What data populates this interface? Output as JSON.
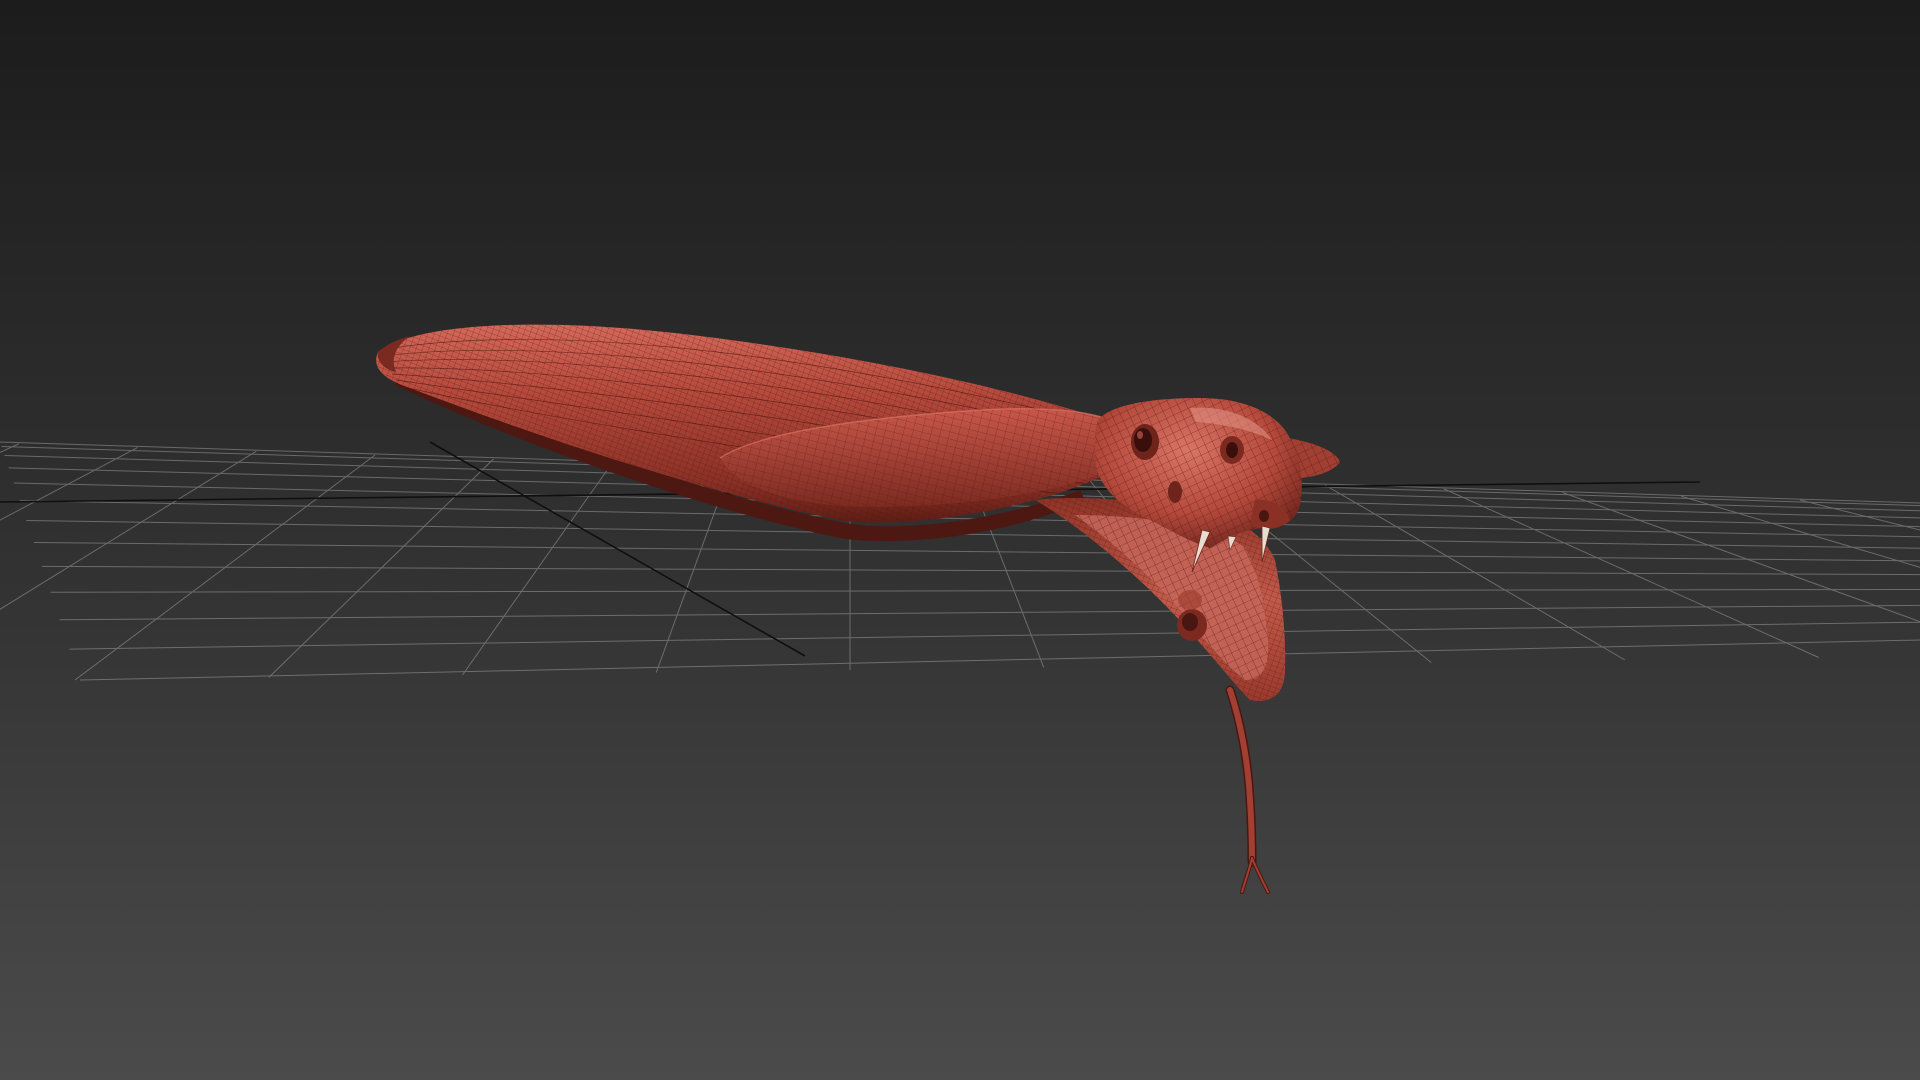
{
  "viewport": {
    "background_top": "#1c1c1c",
    "background_bottom": "#4b4b4b",
    "grid_color": "#9a9a9a",
    "grid_axis_color": "#0f0f0f",
    "show_grid": true
  },
  "model": {
    "display_mode": "shaded-with-wireframe",
    "surface_color": "#b5493c",
    "surface_dark": "#6e241b",
    "surface_light": "#d4685a",
    "wire_color": "#4a1611",
    "fang_color": "#e6dcd0"
  }
}
